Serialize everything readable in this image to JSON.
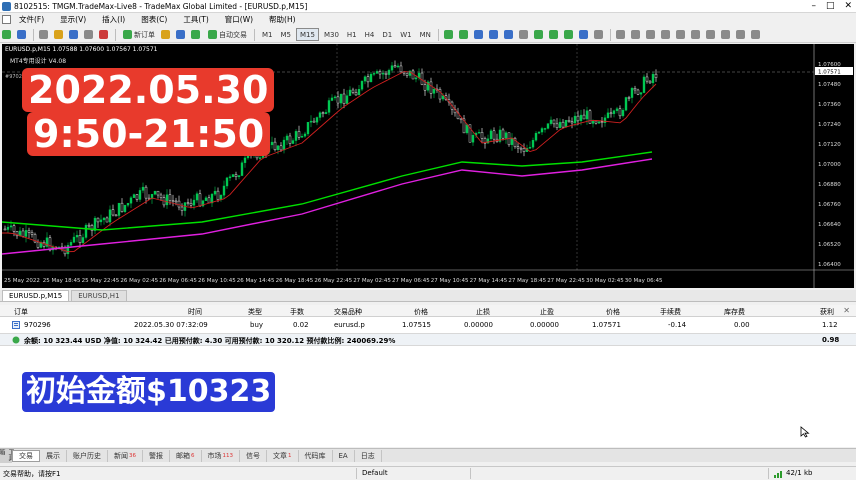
{
  "window": {
    "title": "8102515: TMGM.TradeMax-Live8 - TradeMax Global Limited - [EURUSD.p,M15]"
  },
  "menu": [
    "文件(F)",
    "显示(V)",
    "插入(I)",
    "图表(C)",
    "工具(T)",
    "窗口(W)",
    "帮助(H)"
  ],
  "toolbar": {
    "new_order": "新订单",
    "auto_trading": "自动交易",
    "periods": [
      "M1",
      "M5",
      "M15",
      "M30",
      "H1",
      "H4",
      "D1",
      "W1",
      "MN"
    ]
  },
  "chart": {
    "symbol_label": "EURUSD.p,M15  1.07588 1.07600 1.07567 1.07571",
    "indicator_label": "MT4专用设计 V4.08",
    "id_label": "#970296",
    "price_labels": [
      "1.07600",
      "1.07480",
      "1.07360",
      "1.07240",
      "1.07120",
      "1.07000",
      "1.06880",
      "1.06760",
      "1.06640",
      "1.06520",
      "1.06400"
    ],
    "current_price": "1.07571",
    "time_labels": [
      "25 May 2022",
      "25 May 18:45",
      "25 May 22:45",
      "26 May 02:45",
      "26 May 06:45",
      "26 May 10:45",
      "26 May 14:45",
      "26 May 18:45",
      "26 May 22:45",
      "27 May 02:45",
      "27 May 06:45",
      "27 May 10:45",
      "27 May 14:45",
      "27 May 18:45",
      "27 May 22:45",
      "30 May 02:45",
      "30 May 06:45"
    ],
    "overlay_date": "2022.05.30",
    "overlay_time": "9:50-21:50"
  },
  "chart_tabs": [
    "EURUSD.p,M15",
    "EURUSD,H1"
  ],
  "terminal": {
    "headers": [
      "订单",
      "时间",
      "类型",
      "手数",
      "交易品种",
      "价格",
      "止损",
      "止盈",
      "价格",
      "手续费",
      "库存费",
      "获利"
    ],
    "row": [
      "970296",
      "2022.05.30 07:32:09",
      "buy",
      "0.02",
      "eurusd.p",
      "1.07515",
      "0.00000",
      "0.00000",
      "1.07571",
      "-0.14",
      "0.00",
      "1.12"
    ],
    "balance_text": "余额: 10 323.44 USD  净值: 10 324.42  已用预付款: 4.30  可用预付款: 10 320.12  预付款比例: 240069.29%",
    "balance_profit": "0.98",
    "toolbox_label": "工具箱"
  },
  "overlay_amount": "初始金额$10323",
  "terminal_tabs": [
    {
      "label": "交易",
      "badge": ""
    },
    {
      "label": "展示",
      "badge": ""
    },
    {
      "label": "账户历史",
      "badge": ""
    },
    {
      "label": "新闻",
      "badge": "36"
    },
    {
      "label": "警报",
      "badge": ""
    },
    {
      "label": "邮箱",
      "badge": "6"
    },
    {
      "label": "市场",
      "badge": "113"
    },
    {
      "label": "信号",
      "badge": ""
    },
    {
      "label": "文章",
      "badge": "1"
    },
    {
      "label": "代码库",
      "badge": ""
    },
    {
      "label": "EA",
      "badge": ""
    },
    {
      "label": "日志",
      "badge": ""
    }
  ],
  "status": {
    "left": "交易帮助，请按F1",
    "profile": "Default",
    "traffic": "42/1 kb"
  },
  "colors": {
    "bull_candle": "#00c853",
    "ma_green": "#00e000",
    "ma_magenta": "#e020e0",
    "ma_red": "#d02020",
    "overlay_red": "#e83a2c",
    "overlay_blue": "#2a3ad6"
  }
}
